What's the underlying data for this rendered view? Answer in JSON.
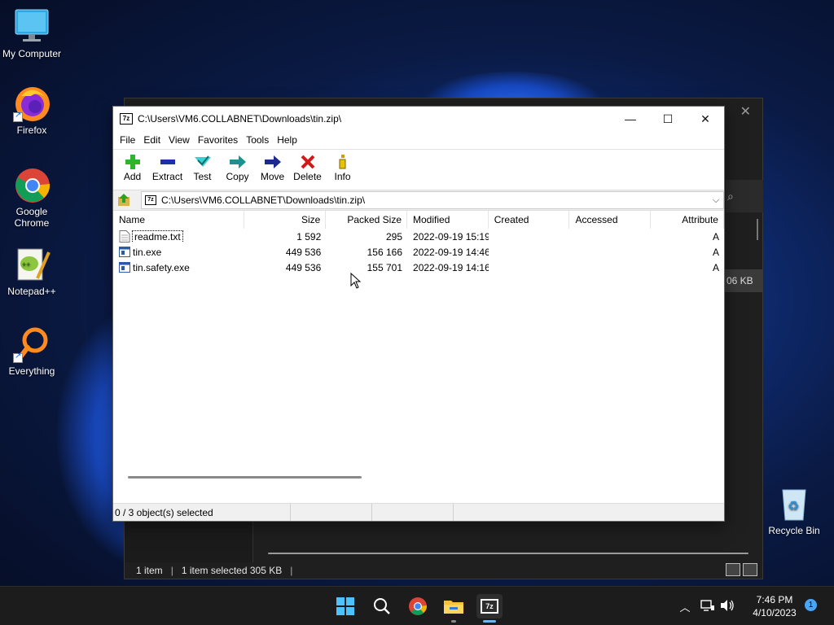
{
  "desktop": {
    "icons": [
      {
        "label": "My Computer",
        "icon": "monitor-icon"
      },
      {
        "label": "Firefox",
        "icon": "firefox-icon"
      },
      {
        "label": "Google Chrome",
        "icon": "chrome-icon"
      },
      {
        "label": "Notepad++",
        "icon": "notepadpp-icon"
      },
      {
        "label": "Everything",
        "icon": "everything-search-icon"
      },
      {
        "label": "Recycle Bin",
        "icon": "recycle-bin-icon"
      }
    ]
  },
  "background_explorer": {
    "size_badge": "06 KB",
    "status": {
      "items": "1 item",
      "selected": "1 item selected  305 KB",
      "sep": "|"
    }
  },
  "sevenzip": {
    "title": "C:\\Users\\VM6.COLLABNET\\Downloads\\tin.zip\\",
    "app_icon_text": "7z",
    "window_controls": {
      "minimize": "—",
      "maximize": "☐",
      "close": "✕"
    },
    "menu": [
      "File",
      "Edit",
      "View",
      "Favorites",
      "Tools",
      "Help"
    ],
    "toolbar": [
      {
        "label": "Add",
        "icon": "add-icon",
        "color": "#2bb52b"
      },
      {
        "label": "Extract",
        "icon": "extract-icon",
        "color": "#1e2fa8"
      },
      {
        "label": "Test",
        "icon": "test-icon",
        "color": "#1fb5b5"
      },
      {
        "label": "Copy",
        "icon": "copy-icon",
        "color": "#1f8f8f"
      },
      {
        "label": "Move",
        "icon": "move-icon",
        "color": "#1c2a8f"
      },
      {
        "label": "Delete",
        "icon": "delete-icon",
        "color": "#d11b1b"
      },
      {
        "label": "Info",
        "icon": "info-icon",
        "color": "#c9a100"
      }
    ],
    "address": "C:\\Users\\VM6.COLLABNET\\Downloads\\tin.zip\\",
    "columns": [
      "Name",
      "Size",
      "Packed Size",
      "Modified",
      "Created",
      "Accessed",
      "Attribute"
    ],
    "files": [
      {
        "name": "readme.txt",
        "size": "1 592",
        "packed": "295",
        "modified": "2022-09-19 15:19",
        "created": "",
        "accessed": "",
        "attr": "A",
        "type": "text"
      },
      {
        "name": "tin.exe",
        "size": "449 536",
        "packed": "156 166",
        "modified": "2022-09-19 14:46",
        "created": "",
        "accessed": "",
        "attr": "A",
        "type": "exe"
      },
      {
        "name": "tin.safety.exe",
        "size": "449 536",
        "packed": "155 701",
        "modified": "2022-09-19 14:16",
        "created": "",
        "accessed": "",
        "attr": "A",
        "type": "exe"
      }
    ],
    "status": {
      "selection": "0 / 3 object(s) selected",
      "cell2": "",
      "cell3": "",
      "cell4": ""
    }
  },
  "taskbar": {
    "apps": [
      {
        "name": "start",
        "icon": "windows-start-icon"
      },
      {
        "name": "search",
        "icon": "search-icon"
      },
      {
        "name": "chrome",
        "icon": "chrome-icon"
      },
      {
        "name": "file-explorer",
        "icon": "folder-icon"
      },
      {
        "name": "7-zip",
        "icon": "sevenzip-icon",
        "label": "7z"
      }
    ],
    "clock": {
      "time": "7:46 PM",
      "date": "4/10/2023"
    },
    "notification_count": "1"
  }
}
